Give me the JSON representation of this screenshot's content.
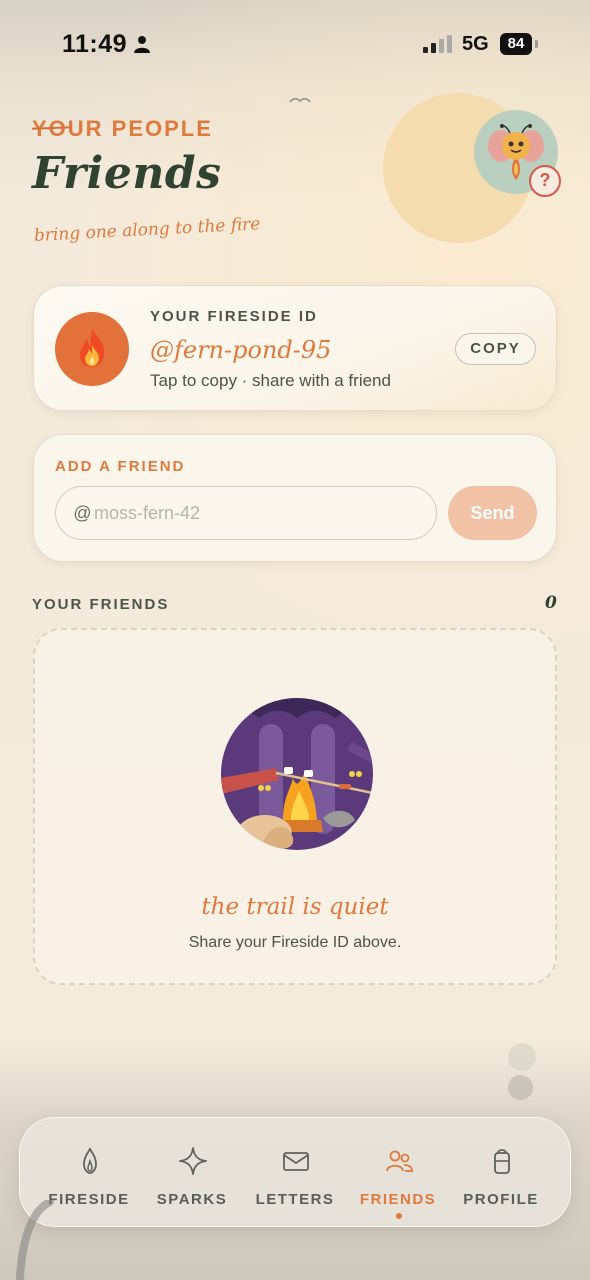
{
  "status_bar": {
    "time": "11:49",
    "network": "5G",
    "battery": "84"
  },
  "header": {
    "eyebrow": "YOUR PEOPLE",
    "title": "Friends",
    "tagline": "bring one along to the fire",
    "avatar_icon": "moth-mascot-icon",
    "help_label": "?"
  },
  "id_card": {
    "label": "YOUR FIRESIDE ID",
    "value": "@fern-pond-95",
    "hint": "Tap to copy · share with a friend",
    "copy_label": "COPY",
    "icon": "fire-icon"
  },
  "add_friend": {
    "label": "ADD A FRIEND",
    "at": "@",
    "placeholder": "moss-fern-42",
    "send_label": "Send"
  },
  "friends": {
    "heading": "YOUR FRIENDS",
    "count": "0",
    "empty_title": "the trail is quiet",
    "empty_subtitle": "Share your Fireside ID above."
  },
  "tabs": [
    {
      "label": "FIRESIDE",
      "icon": "flame-icon",
      "active": false
    },
    {
      "label": "SPARKS",
      "icon": "sparkle-icon",
      "active": false
    },
    {
      "label": "LETTERS",
      "icon": "envelope-icon",
      "active": false
    },
    {
      "label": "FRIENDS",
      "icon": "people-icon",
      "active": true
    },
    {
      "label": "PROFILE",
      "icon": "backpack-icon",
      "active": false
    }
  ],
  "colors": {
    "accent": "#e07a3c",
    "title": "#2f4330",
    "background": "#f4e9da"
  }
}
